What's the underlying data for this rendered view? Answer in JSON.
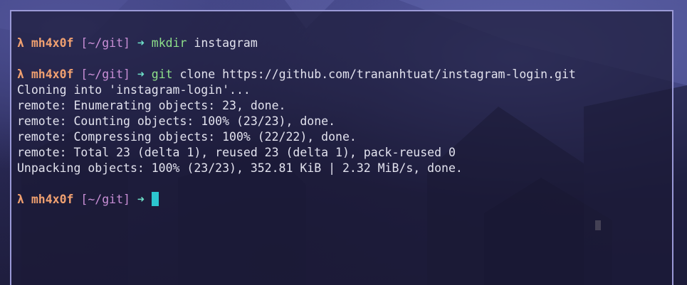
{
  "prompt": {
    "symbol": "λ",
    "user": "mh4x0f",
    "dir": "[~/git]",
    "arrow": "➜"
  },
  "commands": [
    {
      "cmd": "mkdir",
      "args": "instagram"
    },
    {
      "cmd": "git",
      "args": "clone https://github.com/trananhtuat/instagram-login.git"
    }
  ],
  "output": [
    "Cloning into 'instagram-login'...",
    "remote: Enumerating objects: 23, done.",
    "remote: Counting objects: 100% (23/23), done.",
    "remote: Compressing objects: 100% (22/22), done.",
    "remote: Total 23 (delta 1), reused 23 (delta 1), pack-reused 0",
    "Unpacking objects: 100% (23/23), 352.81 KiB | 2.32 MiB/s, done."
  ],
  "colors": {
    "prompt_user": "#f0a070",
    "prompt_dir": "#c98fd6",
    "prompt_arrow": "#6ee0c8",
    "command": "#8ee08a",
    "cursor": "#2cc6cf",
    "window_border": "#9a99d6"
  }
}
